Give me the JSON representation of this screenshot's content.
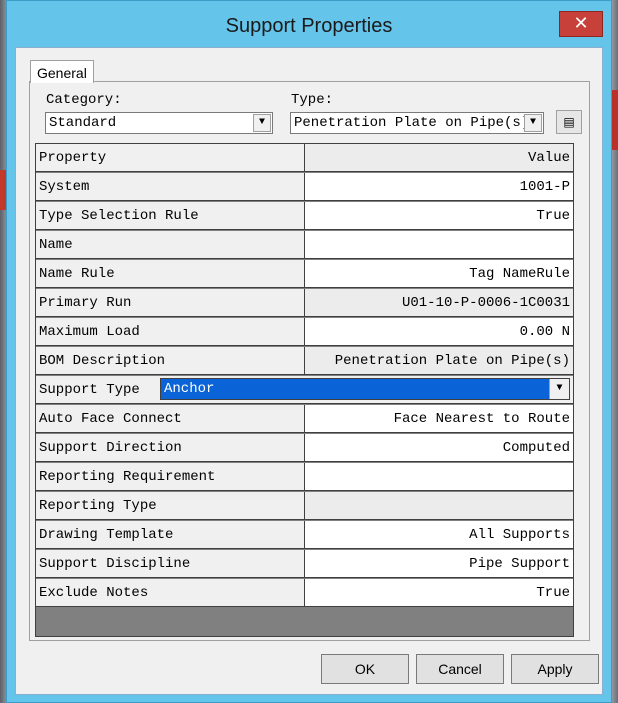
{
  "window": {
    "title": "Support Properties",
    "close_glyph": "✕"
  },
  "tabs": [
    {
      "label": "General"
    }
  ],
  "category": {
    "label": "Category:",
    "value": "Standard"
  },
  "type": {
    "label": "Type:",
    "value": "Penetration Plate on Pipe(s)"
  },
  "grid": {
    "header": {
      "name": "Property",
      "value": "Value"
    },
    "rows": [
      {
        "name": "System",
        "value": "1001-P"
      },
      {
        "name": "Type Selection Rule",
        "value": "True"
      },
      {
        "name": "Name",
        "value": ""
      },
      {
        "name": "Name Rule",
        "value": "Tag NameRule"
      },
      {
        "name": "Primary Run",
        "value": "U01-10-P-0006-1C0031"
      },
      {
        "name": "Maximum Load",
        "value": "0.00 N"
      },
      {
        "name": "BOM Description",
        "value": "Penetration Plate on Pipe(s)"
      },
      {
        "name": "Support Type",
        "value": "Anchor"
      },
      {
        "name": "Auto Face Connect",
        "value": "Face Nearest to Route"
      },
      {
        "name": "Support Direction",
        "value": "Computed"
      },
      {
        "name": "Reporting Requirement",
        "value": ""
      },
      {
        "name": "Reporting Type",
        "value": ""
      },
      {
        "name": "Drawing Template",
        "value": "All Supports"
      },
      {
        "name": "Support Discipline",
        "value": "Pipe Support"
      },
      {
        "name": "Exclude Notes",
        "value": "True"
      }
    ]
  },
  "buttons": {
    "ok": "OK",
    "cancel": "Cancel",
    "apply": "Apply"
  },
  "icons": {
    "dropdown": "chevron-down-icon",
    "properties": "properties-icon"
  },
  "colors": {
    "titlebar": "#64c4ea",
    "selection": "#0a64d8",
    "close": "#c8403a"
  }
}
